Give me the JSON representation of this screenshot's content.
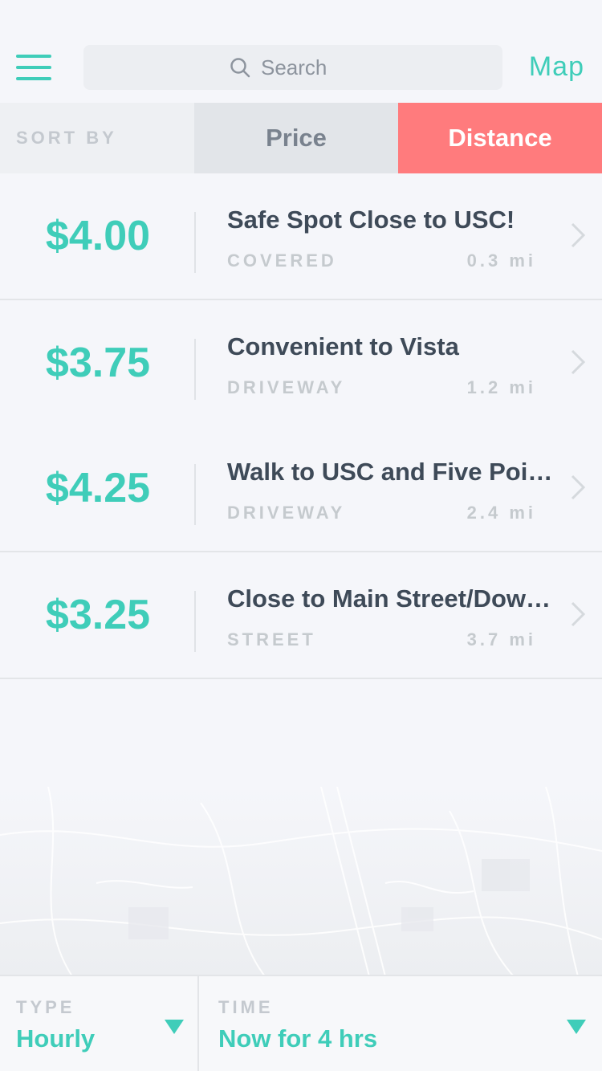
{
  "header": {
    "search_placeholder": "Search",
    "map_label": "Map"
  },
  "sort": {
    "label": "SORT BY",
    "options": [
      "Price",
      "Distance"
    ],
    "selected": "Distance"
  },
  "listings": [
    {
      "price": "$4.00",
      "title": "Safe Spot Close to USC!",
      "type": "COVERED",
      "distance": "0.3 mi"
    },
    {
      "price": "$3.75",
      "title": "Convenient to Vista",
      "type": "DRIVEWAY",
      "distance": "1.2 mi"
    },
    {
      "price": "$4.25",
      "title": "Walk to USC and Five Poi…",
      "type": "DRIVEWAY",
      "distance": "2.4 mi"
    },
    {
      "price": "$3.25",
      "title": "Close to Main Street/Dow…",
      "type": "STREET",
      "distance": "3.7 mi"
    }
  ],
  "footer": {
    "type_label": "TYPE",
    "type_value": "Hourly",
    "time_label": "TIME",
    "time_value": "Now for 4 hrs"
  },
  "colors": {
    "accent": "#3fcdb9",
    "active_sort": "#ff7b7d",
    "text_dark": "#3e4a58",
    "muted": "#c5cace"
  }
}
